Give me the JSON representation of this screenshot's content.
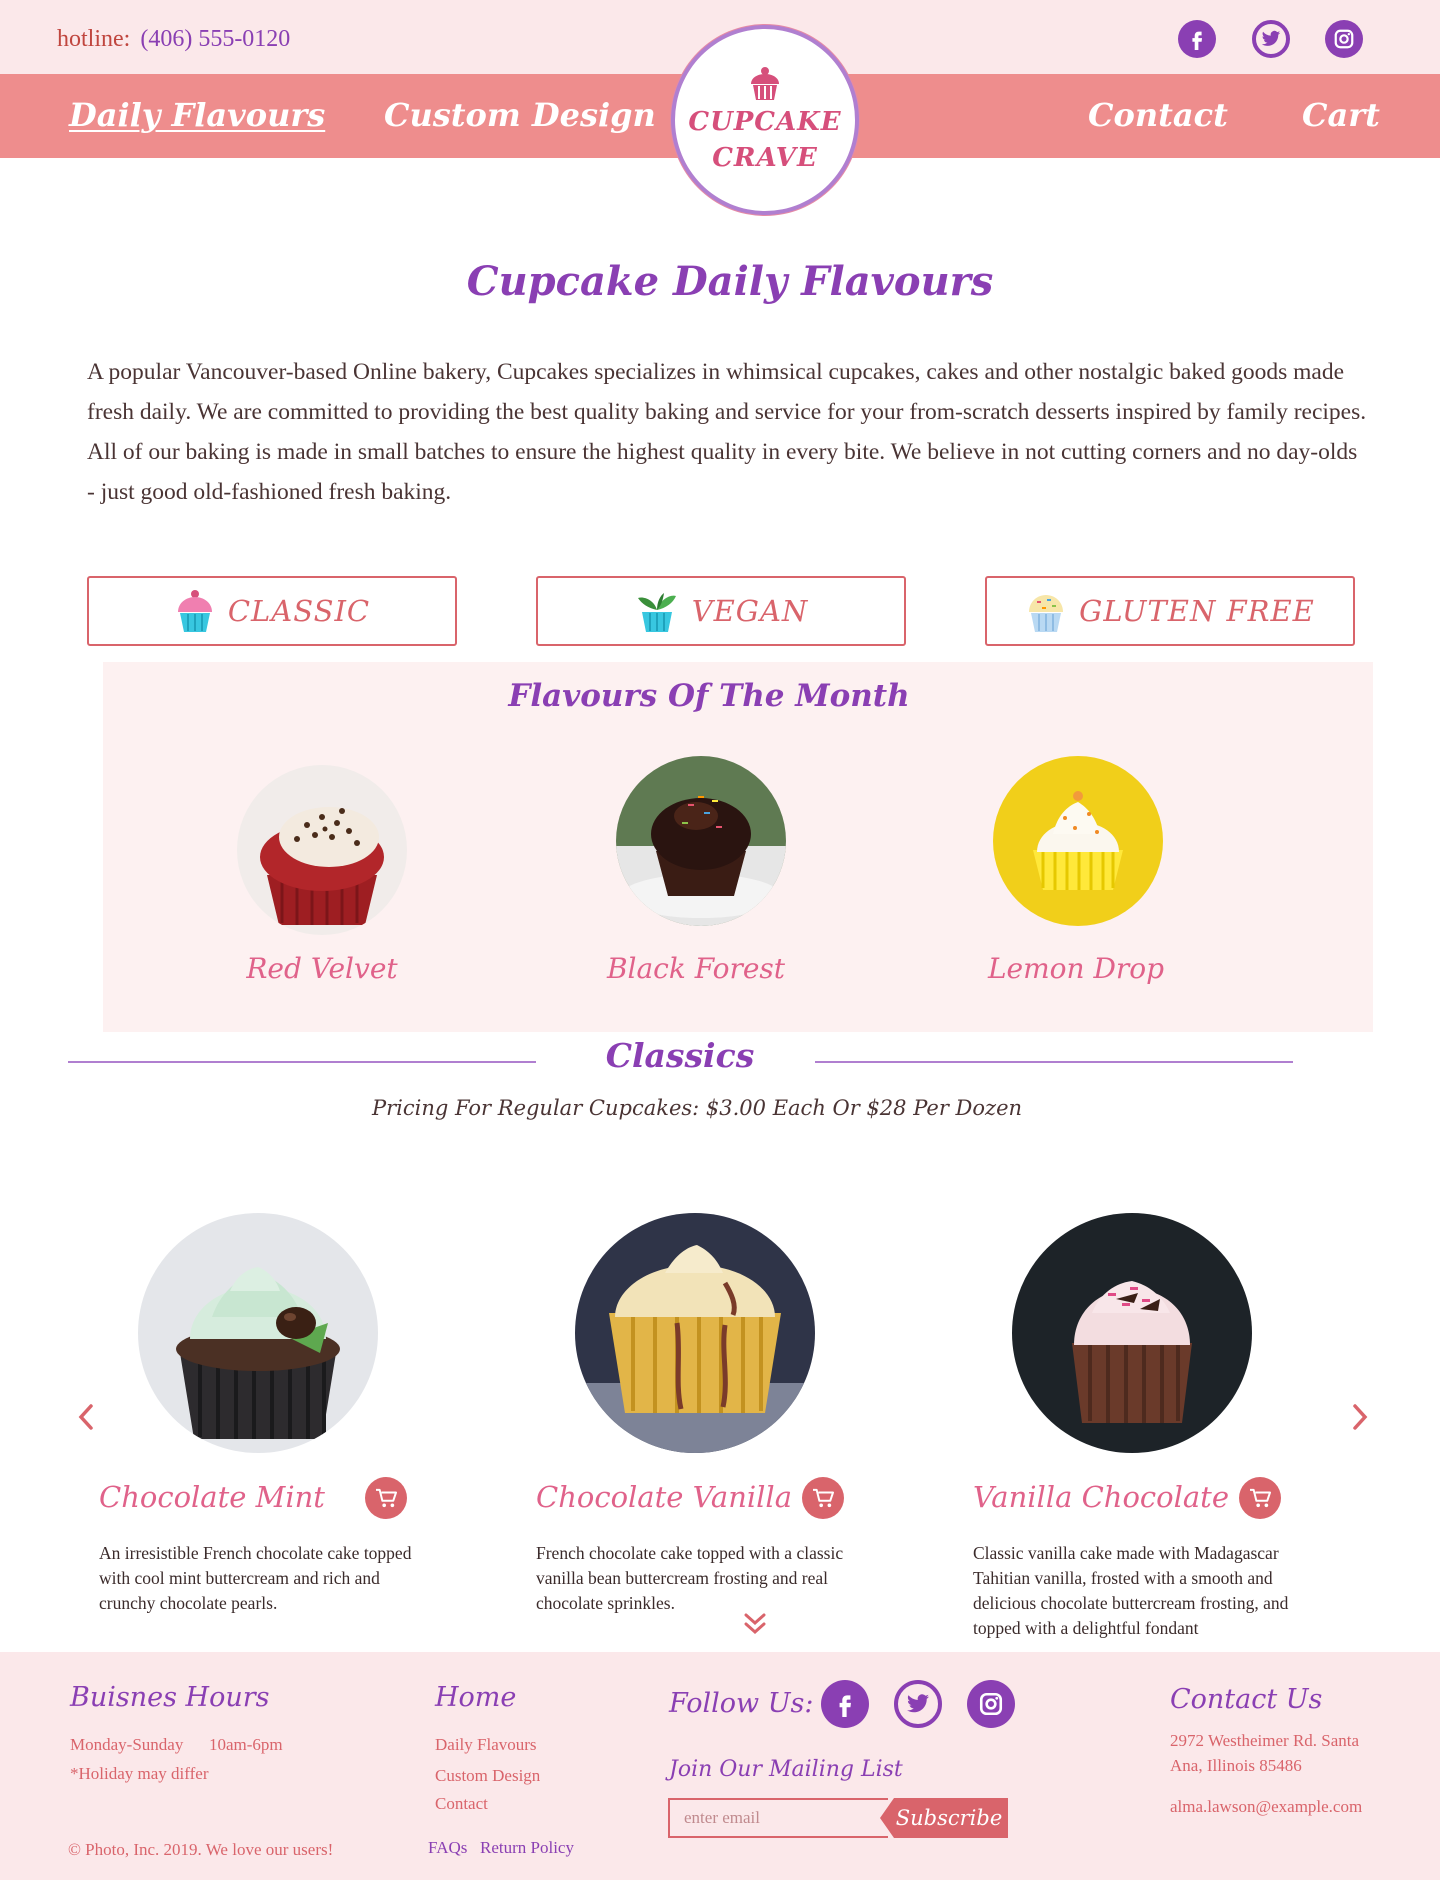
{
  "colors": {
    "accent_pink": "#ee8d8d",
    "brand_purple": "#8a3fb3",
    "rose": "#d9646b",
    "title_pink": "#e0628a",
    "light_bg": "#fbe8ea"
  },
  "header": {
    "hotline_label": "hotline:",
    "hotline_number": "(406) 555-0120",
    "social_icons": [
      "facebook-icon",
      "twitter-icon",
      "instagram-icon"
    ]
  },
  "nav": {
    "daily_flavours": "Daily Flavours",
    "custom_design": "Custom Design",
    "contact": "Contact",
    "cart": "Cart",
    "logo_line1": "CUPCAKE",
    "logo_line2": "CRAVE"
  },
  "main": {
    "title": "Cupcake Daily Flavours",
    "intro": "A popular Vancouver-based Online bakery, Cupcakes specializes in whimsical cupcakes, cakes and other nostalgic baked goods  made fresh daily.  We are committed to providing the best quality baking and service for your  from-scratch desserts inspired by family recipes. All of our baking is made in small batches to ensure the highest quality in every bite. We believe in not cutting corners  and no day-olds - just good old-fashioned fresh baking."
  },
  "categories": [
    {
      "label": "CLASSIC",
      "icon": "pink-cupcake-icon"
    },
    {
      "label": "VEGAN",
      "icon": "plant-cupcake-icon"
    },
    {
      "label": "GLUTEN FREE",
      "icon": "sprinkle-cupcake-icon"
    }
  ],
  "flavours_of_month": {
    "title": "Flavours Of The Month",
    "items": [
      {
        "name": "Red Velvet"
      },
      {
        "name": "Black Forest"
      },
      {
        "name": "Lemon Drop"
      }
    ]
  },
  "classics": {
    "title": "Classics",
    "pricing": "Pricing For Regular Cupcakes: $3.00 Each Or $28 Per Dozen",
    "products": [
      {
        "name": "Chocolate Mint",
        "description": "An irresistible French chocolate cake topped with cool mint buttercream and rich and crunchy chocolate pearls."
      },
      {
        "name": "Chocolate Vanilla",
        "description": "French chocolate cake topped with a classic vanilla bean buttercream frosting and real chocolate sprinkles."
      },
      {
        "name": "Vanilla Chocolate",
        "description": "Classic vanilla cake made with Madagascar Tahitian vanilla, frosted with a smooth and delicious chocolate buttercream frosting, and topped with a delightful fondant"
      }
    ]
  },
  "footer": {
    "hours_title": "Buisnes Hours",
    "hours_days": "Monday-Sunday",
    "hours_time": "10am-6pm",
    "hours_note": "*Holiday may differ",
    "copyright": "© Photo, Inc. 2019. We love our users!",
    "home_title": "Home",
    "home_links": [
      "Daily Flavours",
      "Custom Design",
      "Contact"
    ],
    "faqs": "FAQs",
    "return_policy": "Return Policy",
    "follow_title": "Follow Us:",
    "mailing_title": "Join Our Mailing List",
    "email_placeholder": "enter email",
    "subscribe": "Subscribe",
    "contact_title": "Contact Us",
    "address": "2972 Westheimer Rd. Santa Ana, Illinois 85486",
    "email": "alma.lawson@example.com"
  }
}
